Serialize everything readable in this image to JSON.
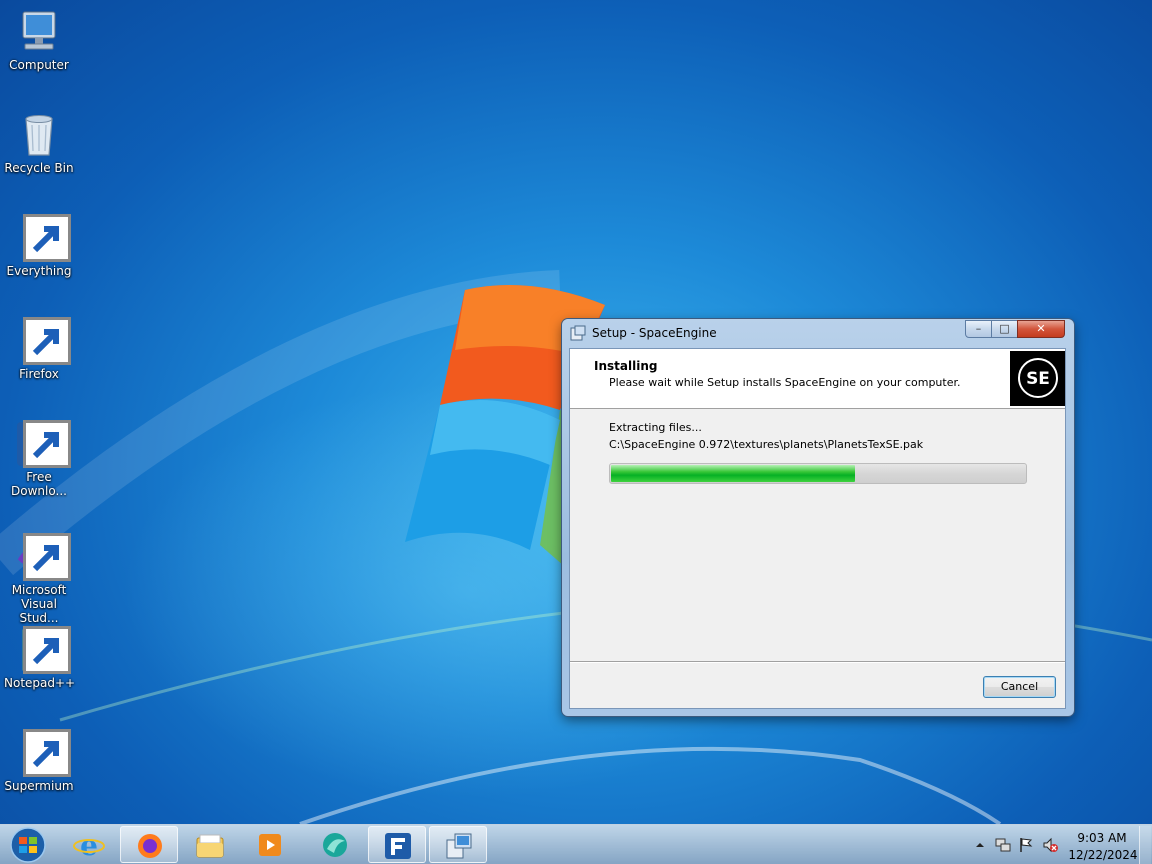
{
  "desktop": {
    "icons": [
      {
        "label": "Computer",
        "icon": "computer-icon"
      },
      {
        "label": "Recycle Bin",
        "icon": "recycle-bin-icon"
      },
      {
        "label": "Everything",
        "icon": "everything-icon"
      },
      {
        "label": "Firefox",
        "icon": "firefox-icon"
      },
      {
        "label": "Free Downlo...",
        "icon": "free-download-manager-icon"
      },
      {
        "label": "Microsoft Visual Stud...",
        "icon": "visual-studio-icon"
      },
      {
        "label": "Notepad++",
        "icon": "notepad-plus-plus-icon"
      },
      {
        "label": "Supermium",
        "icon": "supermium-icon"
      }
    ]
  },
  "dialog": {
    "title": "Setup - SpaceEngine",
    "header_title": "Installing",
    "header_subtitle": "Please wait while Setup installs SpaceEngine on your computer.",
    "status": "Extracting files...",
    "current_file": "C:\\SpaceEngine 0.972\\textures\\planets\\PlanetsTexSE.pak",
    "progress": 0.59,
    "cancel_label": "Cancel",
    "logo_text": "SE"
  },
  "taskbar": {
    "items": [
      "internet-explorer-icon",
      "firefox-icon",
      "file-explorer-icon",
      "media-player-icon",
      "supermium-icon",
      "free-download-manager-icon",
      "setup-icon"
    ],
    "time": "9:03 AM",
    "date": "12/22/2024"
  },
  "colors": {
    "progress": "#06b025",
    "desktop": "#1d8ad8"
  }
}
